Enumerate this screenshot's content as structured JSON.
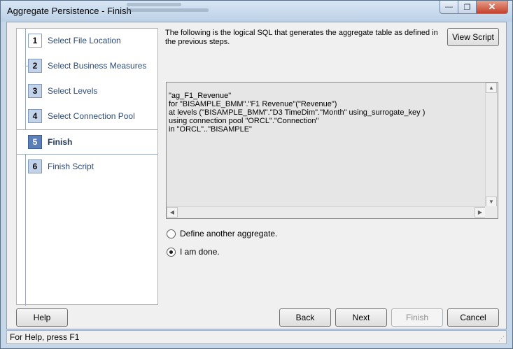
{
  "window": {
    "title": "Aggregate Persistence - Finish",
    "minimize_glyph": "—",
    "restore_glyph": "❐",
    "close_glyph": "✕"
  },
  "steps": [
    {
      "number": "1",
      "label": "Select File Location",
      "state": "done"
    },
    {
      "number": "2",
      "label": "Select Business Measures",
      "state": "done"
    },
    {
      "number": "3",
      "label": "Select Levels",
      "state": "done"
    },
    {
      "number": "4",
      "label": "Select Connection Pool",
      "state": "done"
    },
    {
      "number": "5",
      "label": "Finish",
      "state": "current"
    },
    {
      "number": "6",
      "label": "Finish Script",
      "state": "pending"
    }
  ],
  "description": "The following is the logical SQL that generates the aggregate table as defined in the previous steps.",
  "view_script_label": "View Script",
  "sql_lines": [
    "\"ag_F1_Revenue\"",
    "for \"BISAMPLE_BMM\".\"F1 Revenue\"(\"Revenue\")",
    "at levels (\"BISAMPLE_BMM\".\"D3 TimeDim\".\"Month\" using_surrogate_key )",
    "using connection pool \"ORCL\".\"Connection\"",
    "in \"ORCL\"..\"BISAMPLE\""
  ],
  "options": {
    "define_another": {
      "label": "Define another aggregate.",
      "selected": false
    },
    "done": {
      "label": "I am done.",
      "selected": true
    }
  },
  "buttons": {
    "help": "Help",
    "back": "Back",
    "next": "Next",
    "finish": "Finish",
    "cancel": "Cancel"
  },
  "status": "For Help, press F1",
  "icons": {
    "scroll_up": "scroll-up-arrow-icon",
    "scroll_down": "scroll-down-arrow-icon",
    "scroll_left": "scroll-left-arrow-icon",
    "scroll_right": "scroll-right-arrow-icon"
  }
}
